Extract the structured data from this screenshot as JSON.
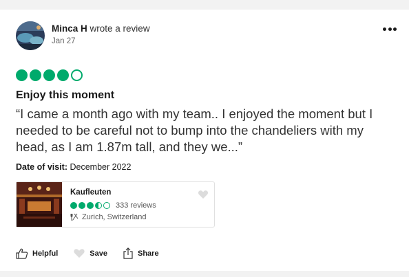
{
  "reviewer": {
    "name": "Minca H",
    "action_text": "wrote a review",
    "date": "Jan 27"
  },
  "review": {
    "rating": 4,
    "rating_max": 5,
    "title": "Enjoy this moment",
    "text": "“I came a month ago with my team.. I enjoyed the moment but I needed to be careful not to bump into the chandeliers with my head, as I am 1.87m tall, and they we...”",
    "visit_label": "Date of visit:",
    "visit_date": "December 2022"
  },
  "place": {
    "name": "Kaufleuten",
    "rating": 3.5,
    "reviews": "333 reviews",
    "location": "Zurich, Switzerland"
  },
  "actions": {
    "helpful": "Helpful",
    "save": "Save",
    "share": "Share"
  },
  "colors": {
    "bubble_green": "#00aa6c",
    "text_primary": "#1a1a1a",
    "text_secondary": "#666666"
  },
  "icons": [
    "more-icon",
    "thumbs-up-icon",
    "heart-icon",
    "share-icon",
    "utensils-icon"
  ]
}
